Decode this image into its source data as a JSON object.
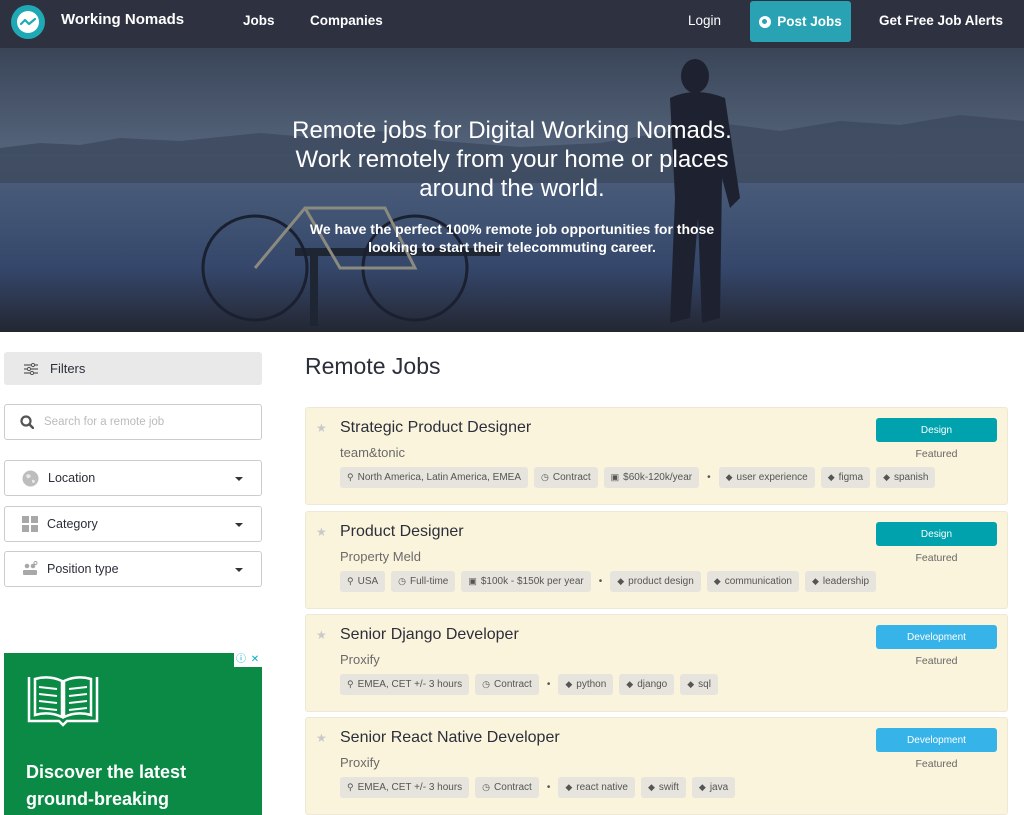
{
  "navbar": {
    "brand": "Working Nomads",
    "links": {
      "jobs": "Jobs",
      "companies": "Companies",
      "login": "Login",
      "post_jobs": "Post Jobs",
      "alerts": "Get Free Job Alerts"
    },
    "colors": {
      "background": "#2d3140",
      "accent": "#29a3b3"
    }
  },
  "hero": {
    "title_lines": [
      "Remote jobs for Digital Working Nomads.",
      "Work remotely from your home or places",
      "around the world."
    ],
    "subtitle_lines": [
      "We have the perfect 100% remote job opportunities for those",
      "looking to start their telecommuting career."
    ]
  },
  "sidebar": {
    "filters_label": "Filters",
    "search_placeholder": "Search for a remote job",
    "search_value": "",
    "location_label": "Location",
    "category_label": "Category",
    "position_type_label": "Position type"
  },
  "ad": {
    "text_lines": [
      "Discover the latest",
      "ground-breaking"
    ],
    "info_icon": "ⓘ",
    "close_icon": "✕"
  },
  "main": {
    "title": "Remote Jobs",
    "jobs": [
      {
        "title": "Strategic Product Designer",
        "company": "team&tonic",
        "location": "North America, Latin America, EMEA",
        "type": "Contract",
        "salary": "$60k-120k/year",
        "tags": [
          "user experience",
          "figma",
          "spanish"
        ],
        "category": "Design",
        "category_color": "#00a3ad",
        "badge": "Featured"
      },
      {
        "title": "Product Designer",
        "company": "Property Meld",
        "location": "USA",
        "type": "Full-time",
        "salary": "$100k - $150k per year",
        "tags": [
          "product design",
          "communication",
          "leadership"
        ],
        "category": "Design",
        "category_color": "#00a3ad",
        "badge": "Featured"
      },
      {
        "title": "Senior Django Developer",
        "company": "Proxify",
        "location": "EMEA, CET +/- 3 hours",
        "type": "Contract",
        "salary": null,
        "tags": [
          "python",
          "django",
          "sql"
        ],
        "category": "Development",
        "category_color": "#36b3e8",
        "badge": "Featured"
      },
      {
        "title": "Senior React Native Developer",
        "company": "Proxify",
        "location": "EMEA, CET +/- 3 hours",
        "type": "Contract",
        "salary": null,
        "tags": [
          "react native",
          "swift",
          "java"
        ],
        "category": "Development",
        "category_color": "#36b3e8",
        "badge": "Featured"
      }
    ]
  }
}
